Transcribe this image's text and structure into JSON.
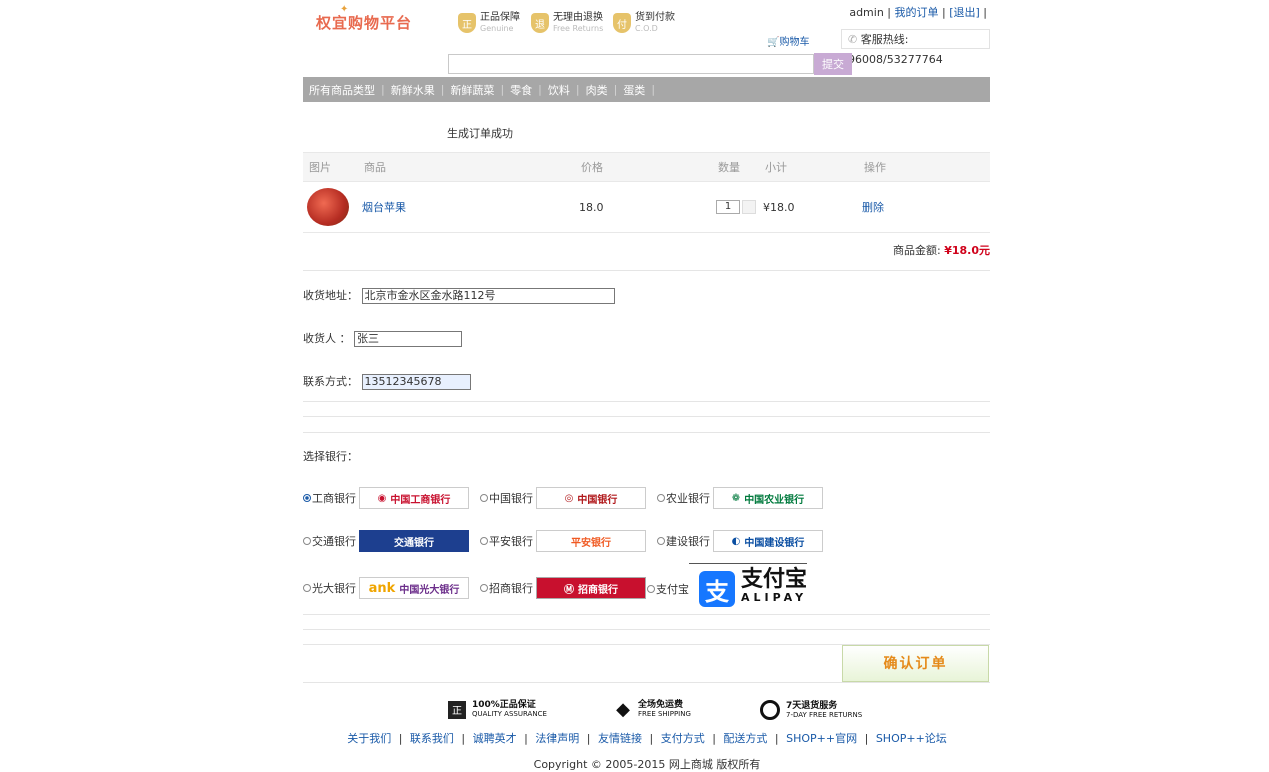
{
  "header": {
    "logo_text": "权宜购物平台",
    "badges": [
      {
        "icon": "genuine-icon",
        "glyph": "正",
        "title": "正品保障",
        "subtitle": "Genuine"
      },
      {
        "icon": "return-icon",
        "glyph": "退",
        "title": "无理由退换",
        "subtitle": "Free Returns"
      },
      {
        "icon": "cod-icon",
        "glyph": "付",
        "title": "货到付款",
        "subtitle": "C.O.D"
      }
    ],
    "user": "admin",
    "my_orders": "我的订单",
    "logout": "[退出]",
    "cart": "购物车",
    "hotline": "客服热线: 96008/53277764"
  },
  "search": {
    "placeholder": "",
    "button": "提交"
  },
  "categories": [
    "所有商品类型",
    "新鲜水果",
    "新鲜蔬菜",
    "零食",
    "饮料",
    "肉类",
    "蛋类"
  ],
  "order": {
    "status": "生成订单成功",
    "columns": [
      "图片",
      "商品",
      "价格",
      "数量",
      "小计",
      "操作"
    ],
    "items": [
      {
        "name": "烟台苹果",
        "price": "18.0",
        "qty": "1",
        "subtotal": "¥18.0",
        "action": "删除"
      }
    ],
    "total_label": "商品金额:",
    "total_value": "¥18.0元"
  },
  "form": {
    "address_label": "收货地址：",
    "address_value": "北京市金水区金水路112号",
    "name_label": "收货人 ：",
    "name_value": "张三",
    "phone_label": "联系方式：",
    "phone_value": "13512345678"
  },
  "payment": {
    "label": "选择银行：",
    "banks": [
      {
        "label": "工商银行",
        "logo": "中国工商银行",
        "selected": true,
        "color": "#c8102e"
      },
      {
        "label": "中国银行",
        "logo": "中国银行",
        "selected": false,
        "color": "#b0181b"
      },
      {
        "label": "农业银行",
        "logo": "中国农业银行",
        "selected": false,
        "color": "#007a3d"
      },
      {
        "label": "交通银行",
        "logo": "交通银行",
        "selected": false,
        "color": "#1d3f8f"
      },
      {
        "label": "平安银行",
        "logo": "平安银行",
        "selected": false,
        "color": "#f05a23"
      },
      {
        "label": "建设银行",
        "logo": "中国建设银行",
        "selected": false,
        "color": "#0a4ea2"
      },
      {
        "label": "光大银行",
        "logo": "中国光大银行",
        "selected": false,
        "color": "#6b2d8a"
      },
      {
        "label": "招商银行",
        "logo": "招商银行",
        "selected": false,
        "color": "#c8102e"
      },
      {
        "label": "支付宝",
        "logo": "支付宝",
        "selected": false,
        "color": "#1677ff"
      }
    ],
    "alipay_cn": "支付宝",
    "alipay_en": "ALIPAY",
    "bank_logo_ank": "ank"
  },
  "confirm_button": "确认订单",
  "guarantees": [
    {
      "icon": "quality-icon",
      "glyph": "正",
      "title": "100%正品保证",
      "subtitle": "QUALITY ASSURANCE"
    },
    {
      "icon": "shipping-icon",
      "glyph": "◆",
      "title": "全场免运费",
      "subtitle": "FREE SHIPPING"
    },
    {
      "icon": "clock-icon",
      "glyph": "",
      "title": "7天退货服务",
      "subtitle": "7-DAY FREE RETURNS"
    }
  ],
  "footer": {
    "links": [
      "关于我们",
      "联系我们",
      "诚聘英才",
      "法律声明",
      "友情链接",
      "支付方式",
      "配送方式",
      "SHOP++官网",
      "SHOP++论坛"
    ],
    "copyright": "Copyright © 2005-2015 网上商城 版权所有"
  }
}
